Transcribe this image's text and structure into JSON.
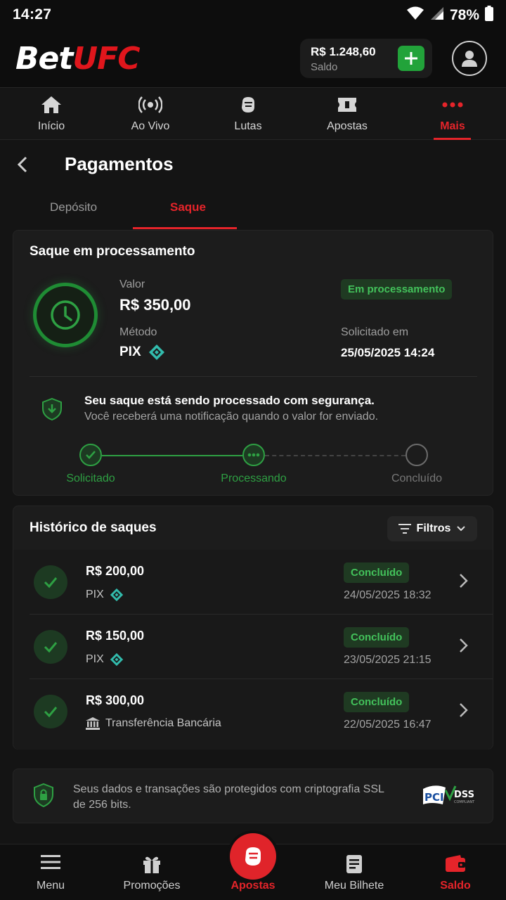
{
  "status_bar": {
    "time": "14:27",
    "battery": "78%"
  },
  "header": {
    "logo_left": "Bet",
    "logo_right": "UFC",
    "balance_amount": "R$ 1.248,60",
    "balance_label": "Saldo"
  },
  "top_nav": [
    {
      "label": "Início",
      "icon": "home-icon"
    },
    {
      "label": "Ao Vivo",
      "icon": "live-icon"
    },
    {
      "label": "Lutas",
      "icon": "glove-icon"
    },
    {
      "label": "Apostas",
      "icon": "ticket-icon"
    },
    {
      "label": "Mais",
      "icon": "more-icon",
      "active": true
    }
  ],
  "page": {
    "title": "Pagamentos"
  },
  "tabs": {
    "deposit": "Depósito",
    "withdraw": "Saque",
    "active": "withdraw"
  },
  "processing": {
    "title": "Saque em processamento",
    "value_label": "Valor",
    "value": "R$ 350,00",
    "method_label": "Método",
    "method": "PIX",
    "status": "Em processamento",
    "requested_label": "Solicitado em",
    "requested_date": "25/05/2025 14:24",
    "secure_title": "Seu saque está sendo processado com segurança.",
    "secure_subtitle": "Você receberá uma notificação quando o valor for enviado.",
    "steps": [
      {
        "label": "Solicitado",
        "state": "done"
      },
      {
        "label": "Processando",
        "state": "current"
      },
      {
        "label": "Concluído",
        "state": "pending"
      }
    ]
  },
  "history": {
    "title": "Histórico de saques",
    "filter_label": "Filtros",
    "rows": [
      {
        "amount": "R$ 200,00",
        "method": "PIX",
        "method_icon": "pix-icon",
        "status": "Concluído",
        "date": "24/05/2025 18:32"
      },
      {
        "amount": "R$ 150,00",
        "method": "PIX",
        "method_icon": "pix-icon",
        "status": "Concluído",
        "date": "23/05/2025 21:15"
      },
      {
        "amount": "R$ 300,00",
        "method": "Transferência Bancária",
        "method_icon": "bank-icon",
        "status": "Concluído",
        "date": "22/05/2025 16:47"
      }
    ]
  },
  "security": {
    "text": "Seus dados e transações são protegidos com criptografia SSL de 256 bits.",
    "pci_main": "PCI",
    "pci_dss": "DSS",
    "pci_small": "COMPLIANT"
  },
  "bottom_nav": [
    {
      "label": "Menu",
      "icon": "menu-icon"
    },
    {
      "label": "Promoções",
      "icon": "gift-icon"
    },
    {
      "label": "Apostas",
      "icon": "glove-icon",
      "highlight": true
    },
    {
      "label": "Meu Bilhete",
      "icon": "receipt-icon"
    },
    {
      "label": "Saldo",
      "icon": "wallet-icon",
      "active": true
    }
  ],
  "colors": {
    "accent_red": "#e5242a",
    "success_green": "#2ea043",
    "background": "#141414"
  }
}
